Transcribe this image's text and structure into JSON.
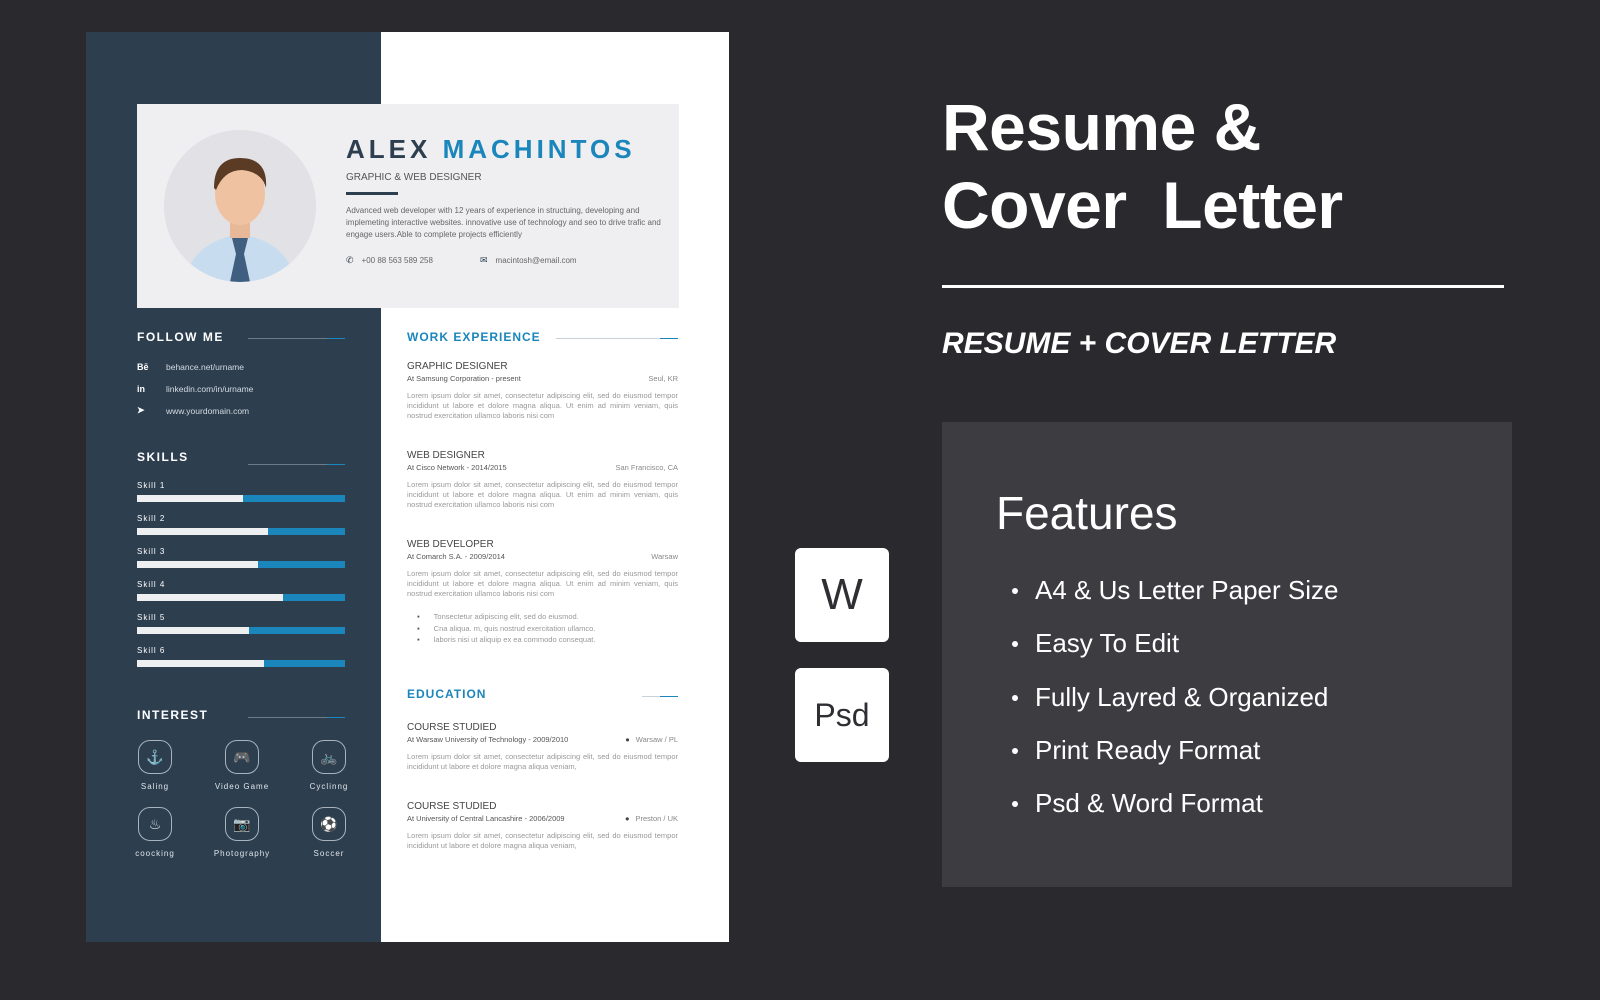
{
  "resume": {
    "name_first": "ALEX",
    "name_last": "MACHINTOS",
    "role": "GRAPHIC & WEB DESIGNER",
    "summary": "Advanced web developer with 12 years of experience in structuing, developing and implemeting interactive websites. innovative use of technology and seo to drive trafic and engage users.Able to complete projects efficiently",
    "phone": "+00 88 563 589 258",
    "email": "macintosh@email.com",
    "follow_heading": "FOLLOW ME",
    "follow": [
      {
        "icon": "behance-icon",
        "glyph": "Bē",
        "label": "behance.net/urname"
      },
      {
        "icon": "linkedin-icon",
        "glyph": "in",
        "label": "linkedin.com/in/urname"
      },
      {
        "icon": "paper-plane-icon",
        "glyph": "➤",
        "label": "www.yourdomain.com"
      }
    ],
    "skills_heading": "SKILLS",
    "skills": [
      {
        "label": "Skill 1",
        "level": 0.51
      },
      {
        "label": "Skill 2",
        "level": 0.63
      },
      {
        "label": "Skill 3",
        "level": 0.58
      },
      {
        "label": "Skill 4",
        "level": 0.7
      },
      {
        "label": "Skill 5",
        "level": 0.54
      },
      {
        "label": "Skill 6",
        "level": 0.61
      }
    ],
    "interest_heading": "INTEREST",
    "interests": [
      {
        "label": "Saling",
        "icon": "anchor-icon",
        "glyph": "⚓"
      },
      {
        "label": "Video Game",
        "icon": "gamepad-icon",
        "glyph": "🎮"
      },
      {
        "label": "Cyclinng",
        "icon": "bicycle-icon",
        "glyph": "🚲"
      },
      {
        "label": "coocking",
        "icon": "chef-hat-icon",
        "glyph": "♨"
      },
      {
        "label": "Photography",
        "icon": "camera-icon",
        "glyph": "📷"
      },
      {
        "label": "Soccer",
        "icon": "soccer-ball-icon",
        "glyph": "⚽"
      }
    ],
    "work_heading": "WORK EXPERIENCE",
    "jobs": [
      {
        "title": "GRAPHIC DESIGNER",
        "company": "At Samsung Corporation - present",
        "location": "Seul, KR",
        "desc": "Lorem ipsum dolor sit amet, consectetur adipiscing elit, sed do eiusmod tempor incididunt ut labore et dolore magna aliqua. Ut enim ad minim veniam, quis nostrud exercitation ullamco laboris nisi com"
      },
      {
        "title": "WEB DESIGNER",
        "company": "At Cisco Network - 2014/2015",
        "location": "San Francisco, CA",
        "desc": "Lorem ipsum dolor sit amet, consectetur adipiscing elit, sed do eiusmod tempor incididunt ut labore et dolore magna aliqua. Ut enim ad minim veniam, quis nostrud exercitation ullamco laboris nisi com"
      },
      {
        "title": "WEB DEVELOPER",
        "company": "At Comarch S.A. - 2009/2014",
        "location": "Warsaw",
        "desc": "Lorem ipsum dolor sit amet, consectetur adipiscing elit, sed do eiusmod tempor incididunt ut labore et dolore magna aliqua. Ut enim ad minim veniam, quis nostrud exercitation ullamco laboris nisi com",
        "bullets": [
          "Tonsectetur adipiscing elit, sed do eiusmod.",
          "Cna aliqua. m, quis nostrud exercitation ullamco.",
          "laboris nisi ut aliquip ex ea commodo consequat."
        ]
      }
    ],
    "education_heading": "EDUCATION",
    "education": [
      {
        "title": "COURSE STUDIED",
        "school": "At Warsaw University of Technology - 2009/2010",
        "location": "Warsaw / PL",
        "desc": "Lorem ipsum dolor sit amet, consectetur adipiscing elit, sed do eiusmod tempor incididunt ut labore et dolore magna aliqua veniam,"
      },
      {
        "title": "COURSE STUDIED",
        "school": "At University of Central Lancashire - 2006/2009",
        "location": "Preston / UK",
        "desc": "Lorem ipsum dolor sit amet, consectetur adipiscing elit, sed do eiusmod tempor incididunt ut labore et dolore magna aliqua veniam,"
      }
    ]
  },
  "promo": {
    "title_line1": "Resume &",
    "title_line2": "Cover  Letter",
    "subtitle": "RESUME + COVER LETTER",
    "formats": [
      "W",
      "Psd"
    ],
    "features_title": "Features",
    "features": [
      "A4  & Us Letter Paper Size",
      "Easy To Edit",
      "Fully Layred & Organized",
      "Print Ready Format",
      "Psd & Word Format"
    ]
  },
  "colors": {
    "background": "#2a292e",
    "sidebar": "#2d3e4f",
    "accent": "#1a86bb",
    "features_panel": "#3d3c41"
  }
}
